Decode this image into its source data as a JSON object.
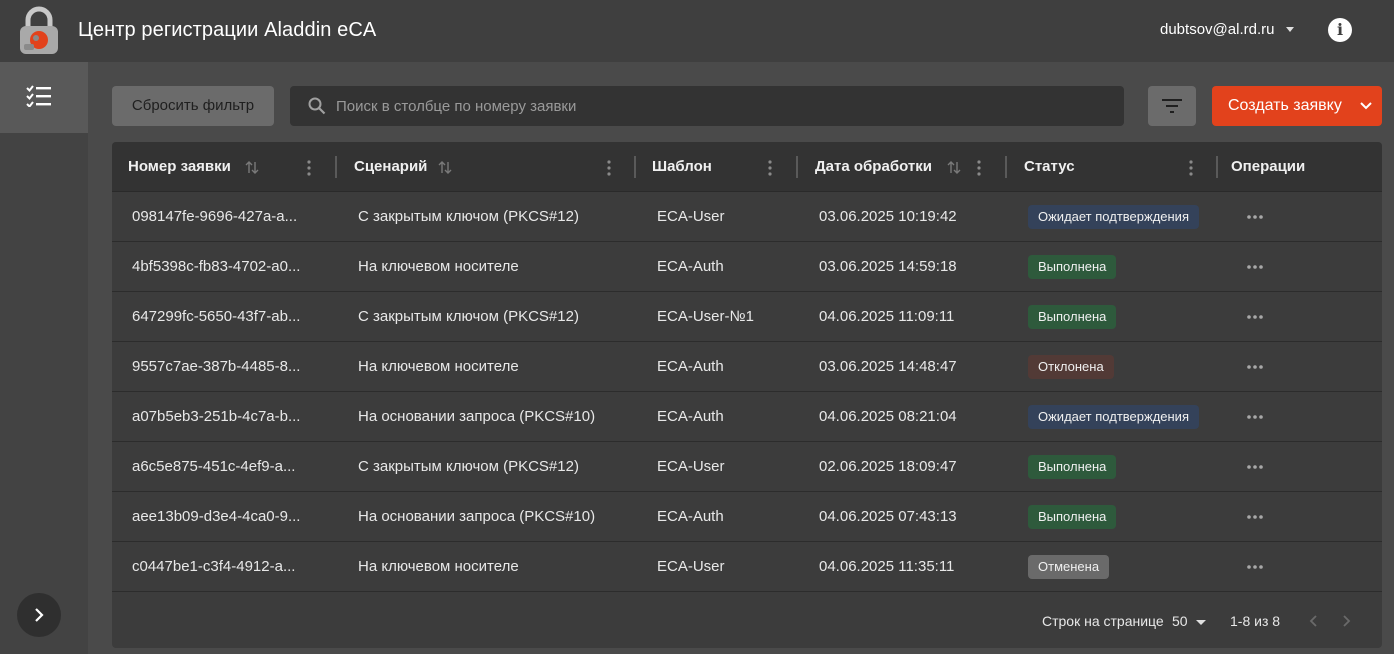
{
  "header": {
    "title": "Центр регистрации Aladdin eCA",
    "user_email": "dubtsov@al.rd.ru"
  },
  "toolbar": {
    "reset_label": "Сбросить фильтр",
    "search_placeholder": "Поиск в столбце по номеру заявки",
    "search_value": "",
    "create_label": "Создать заявку"
  },
  "table": {
    "columns": [
      "Номер заявки",
      "Сценарий",
      "Шаблон",
      "Дата обработки",
      "Статус",
      "Операции"
    ],
    "rows": [
      {
        "id": "098147fe-9696-427a-a...",
        "scenario": "С закрытым ключом (PKCS#12)",
        "template": "ECA-User",
        "date": "03.06.2025 10:19:42",
        "status": "Ожидает подтверждения",
        "status_kind": "pending"
      },
      {
        "id": "4bf5398c-fb83-4702-a0...",
        "scenario": "На ключевом носителе",
        "template": "ECA-Auth",
        "date": "03.06.2025 14:59:18",
        "status": "Выполнена",
        "status_kind": "done"
      },
      {
        "id": "647299fc-5650-43f7-ab...",
        "scenario": "С закрытым ключом (PKCS#12)",
        "template": "ECA-User-№1",
        "date": "04.06.2025 11:09:11",
        "status": "Выполнена",
        "status_kind": "done"
      },
      {
        "id": "9557c7ae-387b-4485-8...",
        "scenario": "На ключевом носителе",
        "template": "ECA-Auth",
        "date": "03.06.2025 14:48:47",
        "status": "Отклонена",
        "status_kind": "rejected"
      },
      {
        "id": "a07b5eb3-251b-4c7a-b...",
        "scenario": "На основании запроса (PKCS#10)",
        "template": "ECA-Auth",
        "date": "04.06.2025 08:21:04",
        "status": "Ожидает подтверждения",
        "status_kind": "pending"
      },
      {
        "id": "a6c5e875-451c-4ef9-a...",
        "scenario": "С закрытым ключом (PKCS#12)",
        "template": "ECA-User",
        "date": "02.06.2025 18:09:47",
        "status": "Выполнена",
        "status_kind": "done"
      },
      {
        "id": "aee13b09-d3e4-4ca0-9...",
        "scenario": "На основании запроса (PKCS#10)",
        "template": "ECA-Auth",
        "date": "04.06.2025 07:43:13",
        "status": "Выполнена",
        "status_kind": "done"
      },
      {
        "id": "c0447be1-c3f4-4912-a...",
        "scenario": "На ключевом носителе",
        "template": "ECA-User",
        "date": "04.06.2025 11:35:11",
        "status": "Отменена",
        "status_kind": "cancelled"
      }
    ]
  },
  "footer": {
    "rows_per_page_label": "Строк на странице",
    "rows_per_page_value": "50",
    "range": "1-8 из 8"
  },
  "colors": {
    "accent": "#e2421c",
    "pending": "#34425a",
    "done": "#2e5a3c",
    "rejected": "#523a36",
    "cancelled": "#6a6a6a"
  },
  "icons": [
    "lock-logo-icon",
    "checklist-icon",
    "chevron-right-icon",
    "search-icon",
    "filter-icon",
    "chevron-down-icon",
    "info-icon",
    "sort-icon",
    "column-menu-icon",
    "more-horizontal-icon",
    "chevron-left-icon"
  ]
}
